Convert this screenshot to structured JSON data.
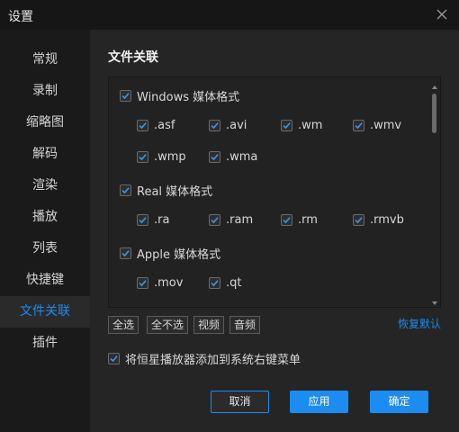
{
  "window": {
    "title": "设置"
  },
  "colors": {
    "accent": "#1c8cf0",
    "sidebar_bg": "#1a1a1a",
    "panel_bg": "#252525",
    "list_bg": "#222222"
  },
  "sidebar": {
    "items": [
      {
        "label": "常规"
      },
      {
        "label": "录制"
      },
      {
        "label": "缩略图"
      },
      {
        "label": "解码"
      },
      {
        "label": "渲染"
      },
      {
        "label": "播放"
      },
      {
        "label": "列表"
      },
      {
        "label": "快捷键"
      },
      {
        "label": "文件关联",
        "active": true
      },
      {
        "label": "插件"
      }
    ]
  },
  "main": {
    "section_title": "文件关联",
    "groups": [
      {
        "label": "Windows 媒体格式",
        "checked": true,
        "extensions": [
          ".asf",
          ".avi",
          ".wm",
          ".wmv",
          ".wmp",
          ".wma"
        ]
      },
      {
        "label": "Real 媒体格式",
        "checked": true,
        "extensions": [
          ".ra",
          ".ram",
          ".rm",
          ".rmvb"
        ]
      },
      {
        "label": "Apple 媒体格式",
        "checked": true,
        "extensions": [
          ".mov",
          ".qt"
        ]
      }
    ],
    "select_buttons": {
      "select_all": "全选",
      "select_none": "全不选",
      "video": "视频",
      "audio": "音频"
    },
    "restore_default": "恢复默认",
    "context_menu_option": {
      "label": "将恒星播放器添加到系统右键菜单",
      "checked": true
    }
  },
  "footer": {
    "cancel": "取消",
    "apply": "应用",
    "ok": "确定"
  }
}
